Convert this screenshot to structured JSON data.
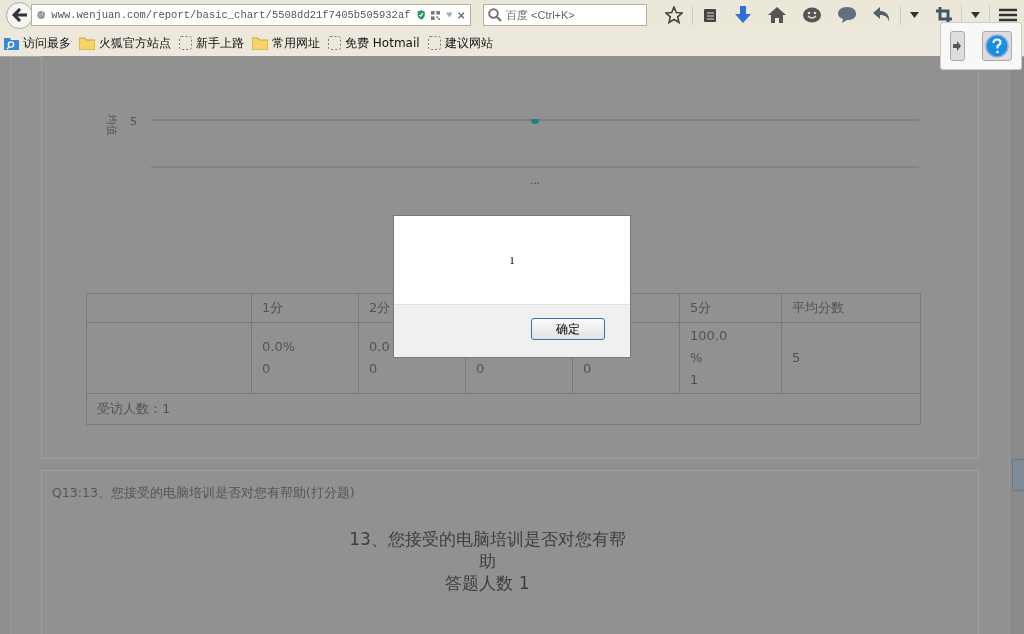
{
  "browser": {
    "url": "www.wenjuan.com/report/basic_chart/5508dd21f7405b505932af",
    "search": {
      "placeholder": "百度 <Ctrl+K>"
    },
    "bookmarks": [
      {
        "label": "访问最多",
        "kind": "smart"
      },
      {
        "label": "火狐官方站点",
        "kind": "folder"
      },
      {
        "label": "新手上路",
        "kind": "page"
      },
      {
        "label": "常用网址",
        "kind": "folder"
      },
      {
        "label": "免费 Hotmail",
        "kind": "page"
      },
      {
        "label": "建议网站",
        "kind": "page"
      }
    ]
  },
  "question_12": {
    "chart": {
      "y_label": "均值",
      "y_tick": "5",
      "x_label": "..."
    },
    "table": {
      "header": {
        "column_2": "1分",
        "column_3": "2分",
        "column_6": "5分",
        "column_7": "平均分数"
      },
      "row": {
        "column_2": [
          "0.0%",
          "0"
        ],
        "column_3": [
          "0.0",
          "0"
        ],
        "column_4": [
          "0"
        ],
        "column_5": [
          "0"
        ],
        "column_6": [
          "100.0",
          "%",
          "1"
        ],
        "column_7": [
          "5"
        ]
      },
      "footer": "受访人数：1"
    }
  },
  "question_13": {
    "heading": "Q13:13、您接受的电脑培训是否对您有帮助(打分题)",
    "chart_title": "13、您接受的电脑培训是否对您有帮助",
    "respondents": "答题人数 1"
  },
  "dialog": {
    "message": "1",
    "button": "确定"
  }
}
